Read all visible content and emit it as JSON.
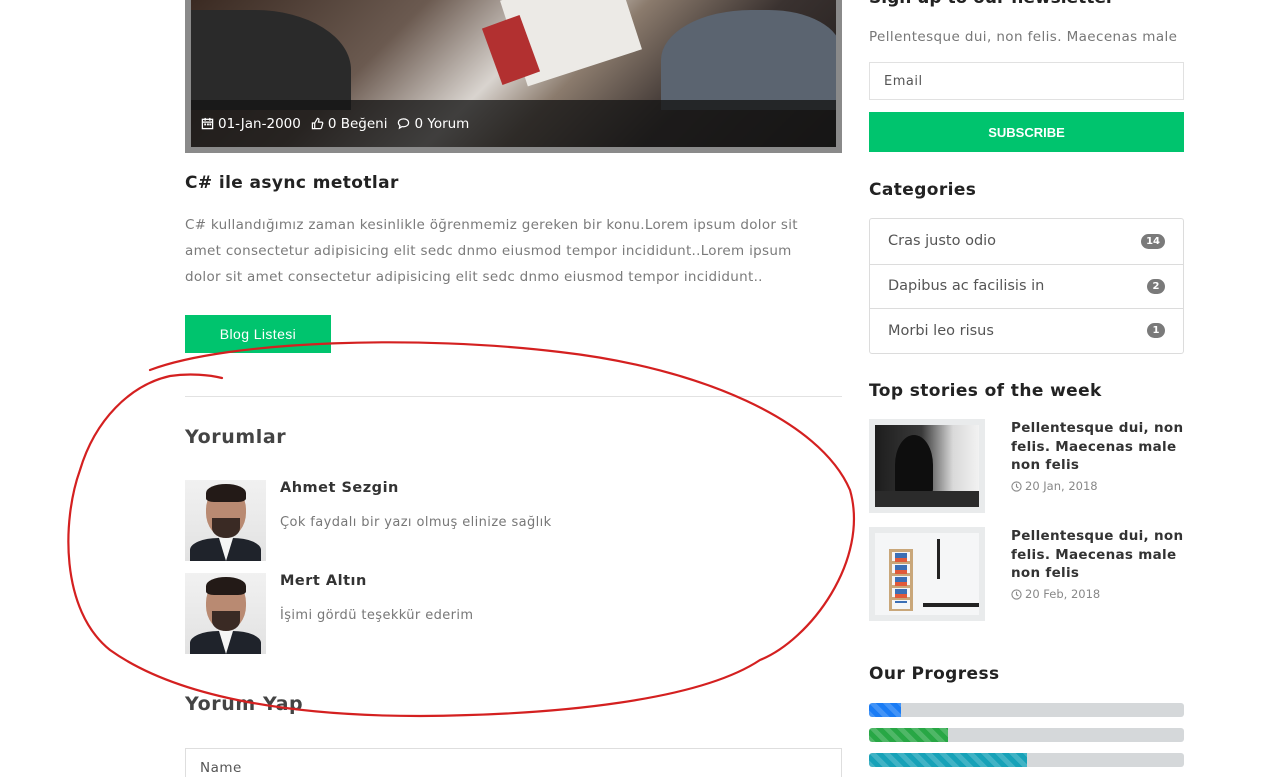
{
  "post": {
    "date": "01-Jan-2000",
    "likes": "0 Beğeni",
    "comments_count": "0 Yorum",
    "title": "C# ile async metotlar",
    "body": "C# kullandığımız zaman kesinlikle öğrenmemiz gereken bir konu.Lorem ipsum dolor sit amet consectetur adipisicing elit sedc dnmo eiusmod tempor incididunt..Lorem ipsum dolor sit amet consectetur adipisicing elit sedc dnmo eiusmod tempor incididunt..",
    "blog_list_button": "Blog Listesi"
  },
  "comments": {
    "title": "Yorumlar",
    "items": [
      {
        "author": "Ahmet Sezgin",
        "text": "Çok faydalı bir yazı olmuş elinize sağlık"
      },
      {
        "author": "Mert Altın",
        "text": "İşimi gördü teşekkür ederim"
      }
    ]
  },
  "reply": {
    "title": "Yorum Yap",
    "name_placeholder": "Name"
  },
  "sidebar": {
    "newsletter": {
      "title": "Sign up to our newsletter",
      "text": "Pellentesque dui, non felis. Maecenas male",
      "email_placeholder": "Email",
      "subscribe_label": "SUBSCRIBE"
    },
    "categories": {
      "title": "Categories",
      "items": [
        {
          "label": "Cras justo odio",
          "count": "14"
        },
        {
          "label": "Dapibus ac facilisis in",
          "count": "2"
        },
        {
          "label": "Morbi leo risus",
          "count": "1"
        }
      ]
    },
    "top_stories": {
      "title": "Top stories of the week",
      "items": [
        {
          "title": "Pellentesque dui, non felis. Maecenas male non felis",
          "date": "20 Jan, 2018"
        },
        {
          "title": "Pellentesque dui, non felis. Maecenas male non felis",
          "date": "20 Feb, 2018"
        }
      ]
    },
    "progress": {
      "title": "Our Progress",
      "bars": [
        {
          "percent": 10,
          "color": "#1a7cf5"
        },
        {
          "percent": 25,
          "color": "#28a745"
        },
        {
          "percent": 50,
          "color": "#17a2b8"
        }
      ]
    }
  },
  "colors": {
    "accent": "#00c46e",
    "annotation": "#d42020"
  }
}
